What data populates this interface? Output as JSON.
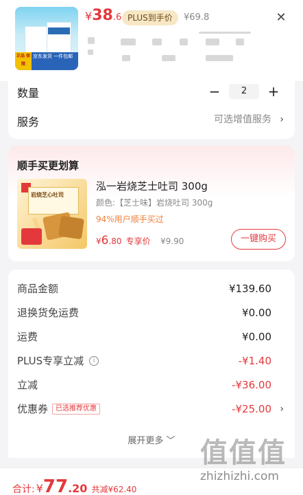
{
  "header": {
    "price_currency": "¥",
    "price_int": "38",
    "price_dec": ".6",
    "plus_tag": "PLUS到手价",
    "original_price": "¥69.8",
    "thumb_badge": "正品\n保障",
    "thumb_tag": "京东发货 一件包邮"
  },
  "options": {
    "quantity_label": "数量",
    "quantity_value": "2",
    "minus": "−",
    "plus": "+",
    "service_label": "服务",
    "service_value": "可选增值服务",
    "chevron": "›"
  },
  "deal": {
    "title": "顺手买更划算",
    "product_name": "泓一岩烧芝士吐司 300g",
    "spec": "颜色:【芝士味】岩烧吐司 300g",
    "buy_ratio": "94%用户顺手买过",
    "price_currency": "¥",
    "price_int": "6",
    "price_dec": ".80",
    "price_label": "专享价",
    "original_price": "¥9.90",
    "buy_button": "一键购买",
    "image_box_text": "岩烧芝心吐司"
  },
  "summary": {
    "rows": [
      {
        "label": "商品金额",
        "value": "¥139.60"
      },
      {
        "label": "退换货免运费",
        "value": "¥0.00"
      },
      {
        "label": "运费",
        "value": "¥0.00"
      },
      {
        "label": "PLUS专享立减",
        "value": "-¥1.40"
      },
      {
        "label": "立减",
        "value": "-¥36.00"
      },
      {
        "label": "优惠券",
        "value": "-¥25.00",
        "tag": "已选推荐优惠"
      }
    ],
    "info_icon": "i",
    "chevron": "›",
    "expand": "展开更多 ﹀"
  },
  "footer": {
    "total_label": "合计:",
    "total_currency": "¥",
    "total_int": "77",
    "total_dec": ".20",
    "saved": "共减¥62.40"
  },
  "watermark": {
    "big": "值值值",
    "small": "zhizhizhi.com"
  },
  "close_icon": "✕",
  "colors": {
    "accent": "#e4393c",
    "plus_tag_bg": "#f7e7c5",
    "page_bg": "#f4f4f6"
  }
}
